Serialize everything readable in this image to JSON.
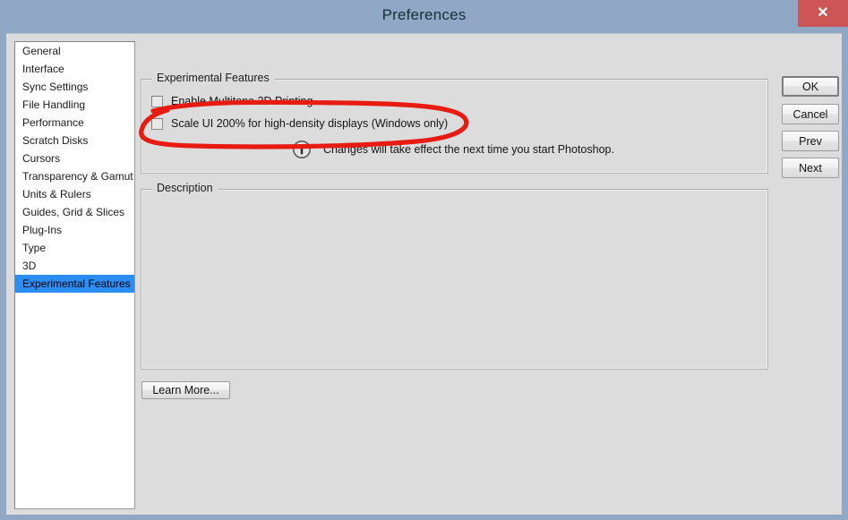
{
  "window": {
    "title": "Preferences",
    "close_label": "✕",
    "titlebar_color": "#90a8c5",
    "close_color": "#cd5555",
    "background_color": "#dcdcdc"
  },
  "sidebar": {
    "selected_color": "#2b8ef5",
    "items": [
      {
        "label": "General",
        "selected": false
      },
      {
        "label": "Interface",
        "selected": false
      },
      {
        "label": "Sync Settings",
        "selected": false
      },
      {
        "label": "File Handling",
        "selected": false
      },
      {
        "label": "Performance",
        "selected": false
      },
      {
        "label": "Scratch Disks",
        "selected": false
      },
      {
        "label": "Cursors",
        "selected": false
      },
      {
        "label": "Transparency & Gamut",
        "selected": false
      },
      {
        "label": "Units & Rulers",
        "selected": false
      },
      {
        "label": "Guides, Grid & Slices",
        "selected": false
      },
      {
        "label": "Plug-Ins",
        "selected": false
      },
      {
        "label": "Type",
        "selected": false
      },
      {
        "label": "3D",
        "selected": false
      },
      {
        "label": "Experimental Features",
        "selected": true
      }
    ]
  },
  "experimental": {
    "group_title": "Experimental Features",
    "options": [
      {
        "label": "Enable Multitone 3D Printing",
        "checked": false
      },
      {
        "label": "Scale UI 200% for high-density displays (Windows only)",
        "checked": false
      }
    ],
    "note": "Changes will take effect the next time you start Photoshop.",
    "note_icon": "info-icon"
  },
  "description": {
    "group_title": "Description",
    "body": ""
  },
  "buttons": {
    "ok": "OK",
    "cancel": "Cancel",
    "prev": "Prev",
    "next": "Next",
    "learn_more": "Learn More..."
  },
  "annotation": {
    "shape": "hand-drawn-ellipse",
    "color": "#e81b12",
    "targets": "Scale UI 200% for high-density displays (Windows only)"
  }
}
